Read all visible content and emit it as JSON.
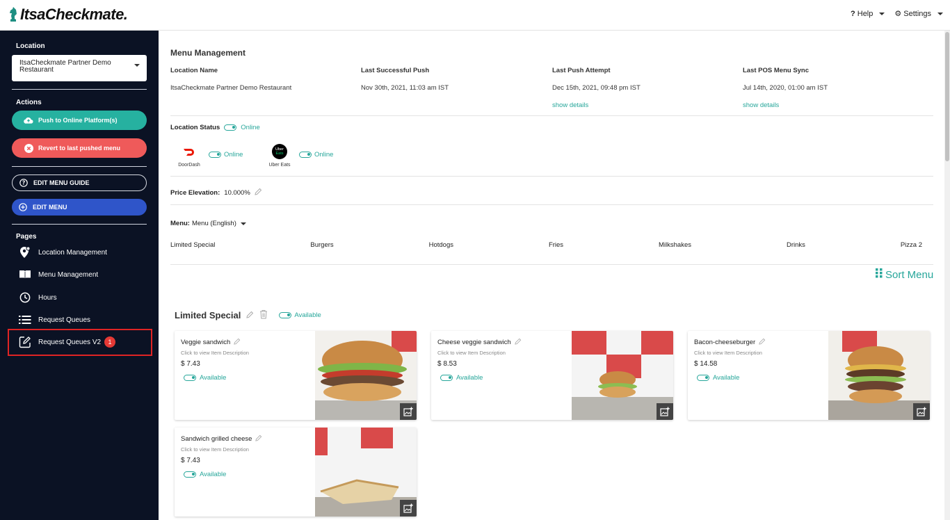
{
  "app": {
    "logo_text": "ItsaCheckmate."
  },
  "topbar": {
    "help_label": "Help",
    "settings_label": "Settings"
  },
  "sidebar": {
    "location_heading": "Location",
    "location_value": "ItsaCheckmate Partner Demo Restaurant",
    "actions_heading": "Actions",
    "push_label": "Push to Online Platform(s)",
    "revert_label": "Revert to last pushed menu",
    "edit_guide_label": "EDIT MENU GUIDE",
    "edit_menu_label": "EDIT MENU",
    "pages_heading": "Pages",
    "pages": [
      {
        "label": "Location Management",
        "icon": "location-gear-icon"
      },
      {
        "label": "Menu Management",
        "icon": "book-icon"
      },
      {
        "label": "Hours",
        "icon": "clock-icon"
      },
      {
        "label": "Request Queues",
        "icon": "list-icon"
      },
      {
        "label": "Request Queues V2",
        "icon": "edit-square-icon",
        "badge": "1"
      }
    ]
  },
  "main": {
    "title": "Menu Management",
    "info": [
      {
        "heading": "Location Name",
        "value": "ItsaCheckmate Partner Demo Restaurant",
        "link": ""
      },
      {
        "heading": "Last Successful Push",
        "value": "Nov 30th, 2021, 11:03 am IST",
        "link": ""
      },
      {
        "heading": "Last Push Attempt",
        "value": "Dec 15th, 2021, 09:48 pm IST",
        "link": "show details"
      },
      {
        "heading": "Last POS Menu Sync",
        "value": "Jul 14th, 2020, 01:00 am IST",
        "link": "show details"
      }
    ],
    "location_status_label": "Location Status",
    "location_status_value": "Online",
    "platforms": [
      {
        "name": "DoorDash",
        "status": "Online"
      },
      {
        "name": "Uber Eats",
        "logo_text": "Uber Eats",
        "status": "Online"
      }
    ],
    "price_elevation_label": "Price Elevation:",
    "price_elevation_value": "10.000%",
    "menu_label": "Menu:",
    "menu_value": "Menu (English)",
    "categories": [
      "Limited Special",
      "Burgers",
      "Hotdogs",
      "Fries",
      "Milkshakes",
      "Drinks",
      "Pizza 2"
    ],
    "sort_menu_label": "Sort Menu",
    "section": {
      "title": "Limited Special",
      "status": "Available"
    },
    "items": [
      {
        "name": "Veggie sandwich",
        "desc": "Click to view Item Description",
        "price": "$ 7.43",
        "status": "Available"
      },
      {
        "name": "Cheese veggie sandwich",
        "desc": "Click to view Item Description",
        "price": "$ 8.53",
        "status": "Available"
      },
      {
        "name": "Bacon-cheeseburger",
        "desc": "Click to view Item Description",
        "price": "$ 14.58",
        "status": "Available"
      },
      {
        "name": "Sandwich grilled cheese",
        "desc": "Click to view Item Description",
        "price": "$ 7.43",
        "status": "Available"
      }
    ]
  },
  "colors": {
    "teal": "#26a69a",
    "sidebar_bg": "#0b1224",
    "red": "#ef5a5a",
    "blue": "#2f55c9",
    "highlight": "#e02424"
  }
}
